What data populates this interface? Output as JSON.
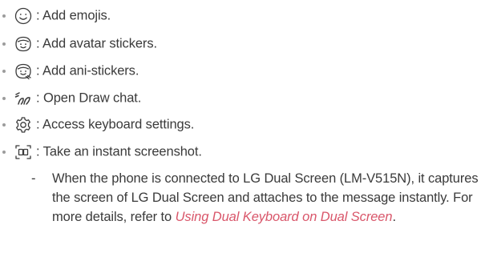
{
  "items": [
    {
      "icon": "smiley-face-icon",
      "text": ": Add emojis."
    },
    {
      "icon": "avatar-sticker-icon",
      "text": ": Add avatar stickers."
    },
    {
      "icon": "ani-sticker-icon",
      "text": ": Add ani-stickers."
    },
    {
      "icon": "draw-chat-icon",
      "text": ": Open Draw chat."
    },
    {
      "icon": "gear-icon",
      "text": ": Access keyboard settings."
    },
    {
      "icon": "screenshot-icon",
      "text": ": Take an instant screenshot."
    }
  ],
  "note": {
    "dash": "-",
    "text": "When the phone is connected to LG Dual Screen (LM-V515N), it captures the screen of LG Dual Screen and attaches to the message instantly. For more details, refer to",
    "link": "Using Dual Keyboard on Dual Screen",
    "end": "."
  },
  "colors": {
    "text": "#3a3a3a",
    "link": "#d9566a",
    "bullet": "#9c9c9c"
  }
}
